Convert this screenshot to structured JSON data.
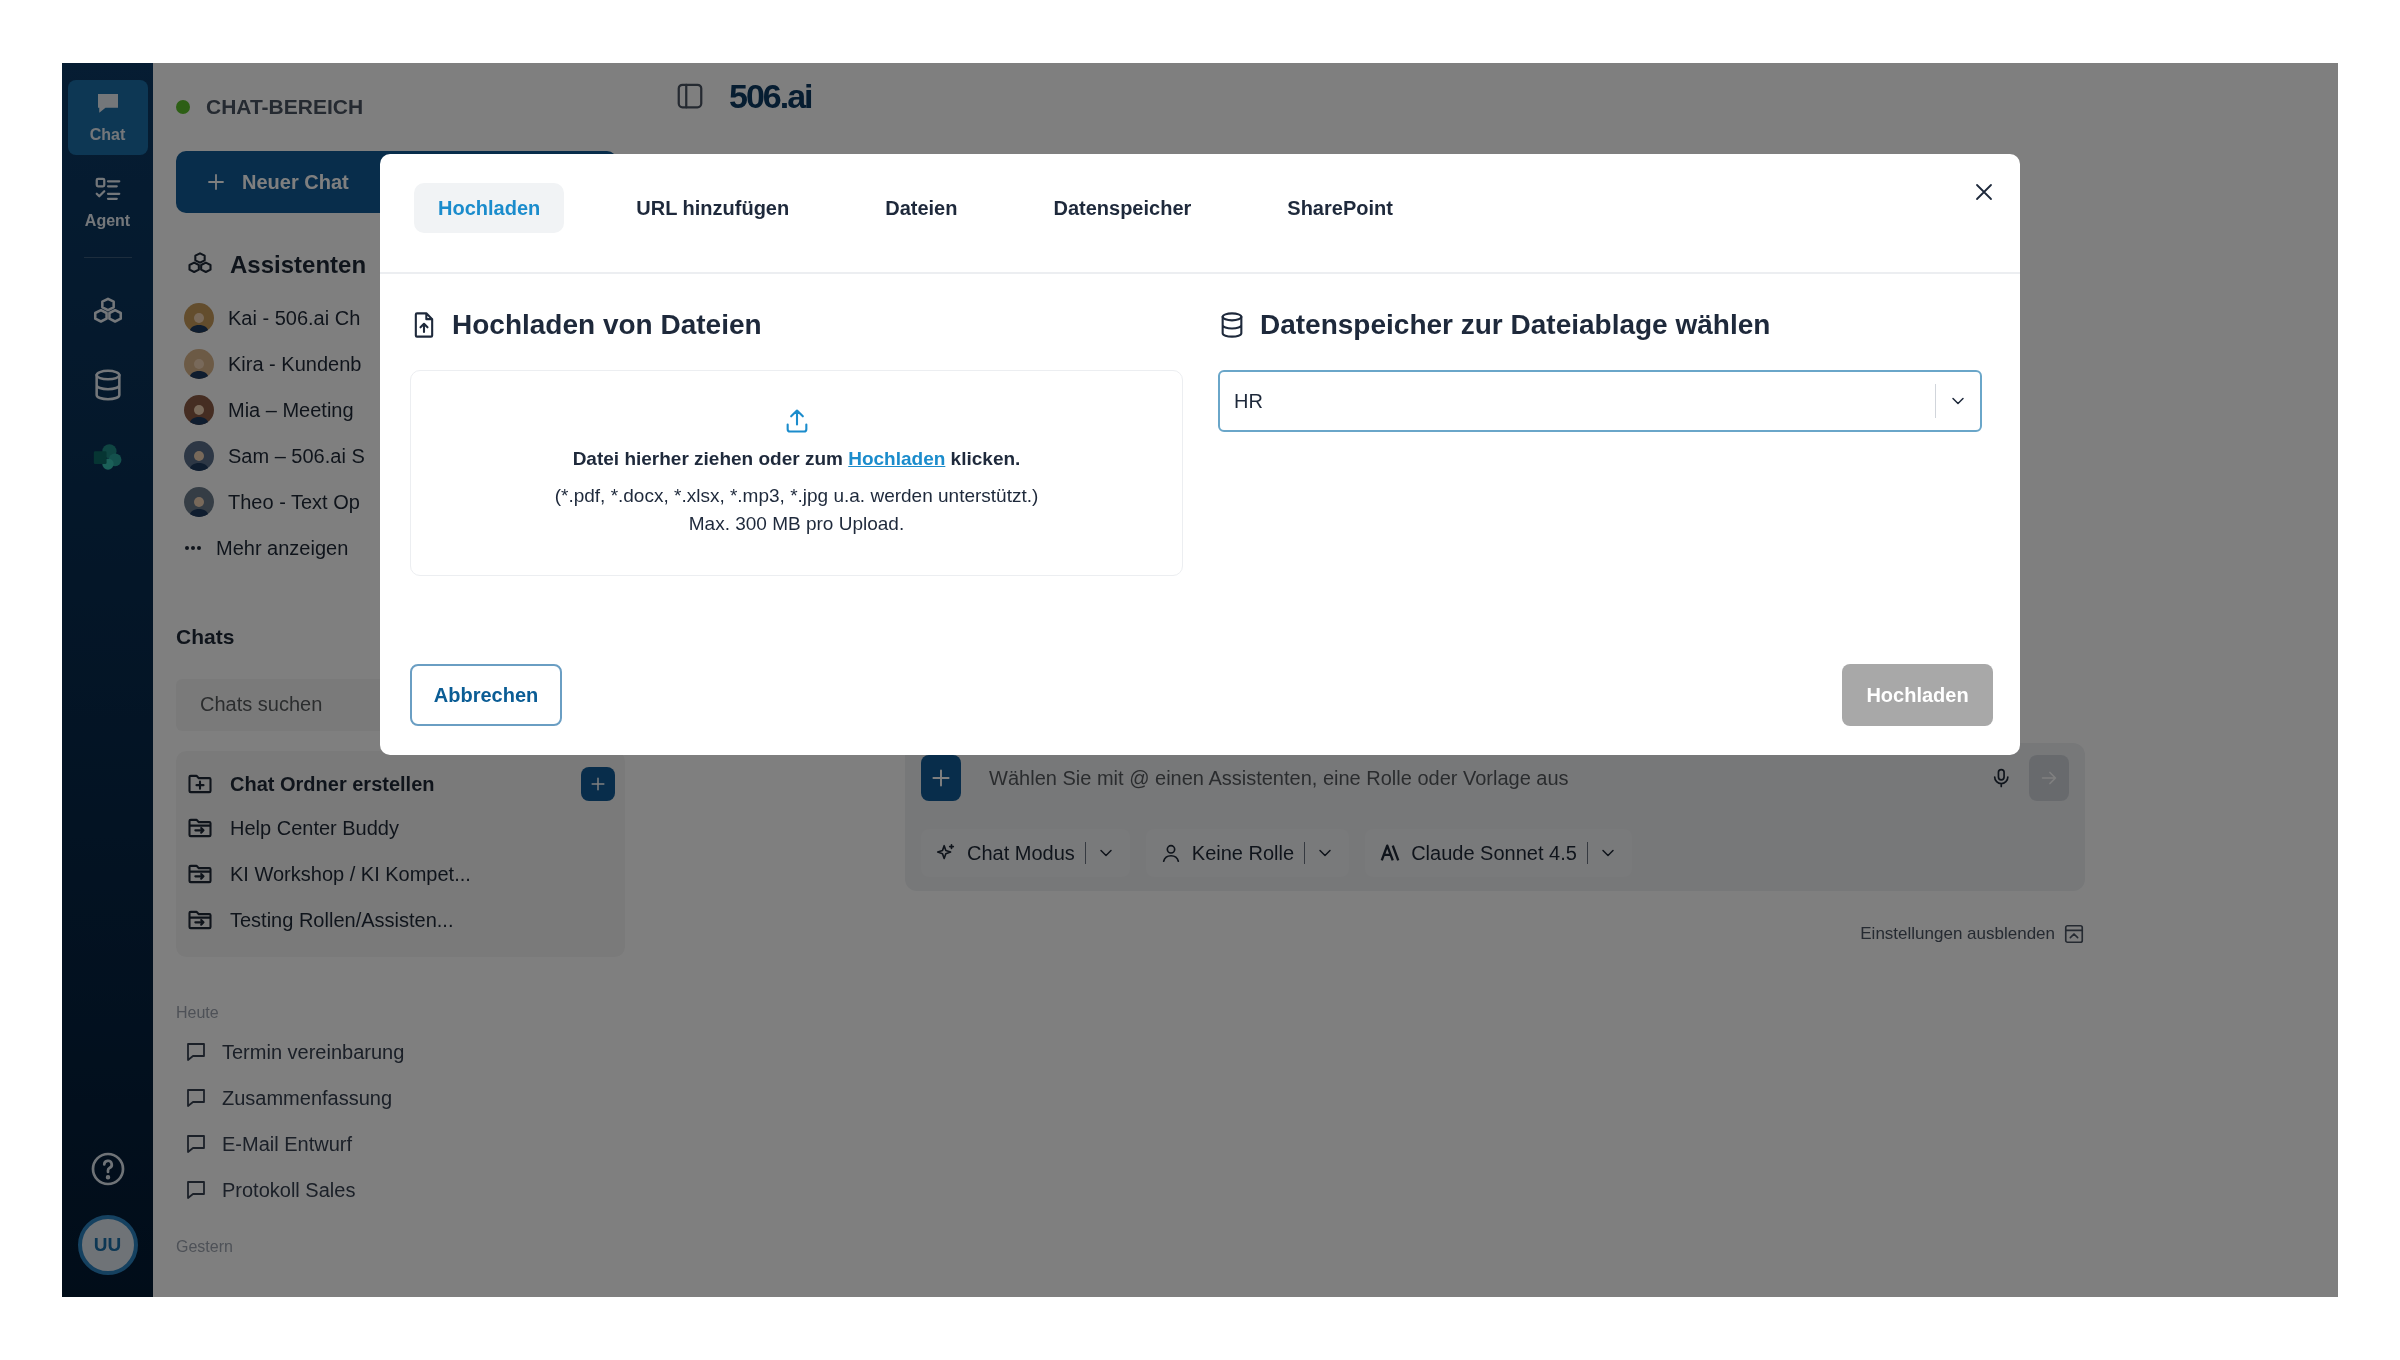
{
  "rail": {
    "items": [
      {
        "kind": "chat",
        "label": "Chat",
        "selected": true
      },
      {
        "kind": "agent",
        "label": "Agent",
        "selected": false
      },
      {
        "kind": "assistants",
        "selected": false
      },
      {
        "kind": "database",
        "selected": false
      },
      {
        "kind": "sharepoint",
        "selected": false
      }
    ],
    "avatar": "UU"
  },
  "sidebar": {
    "area_title": "CHAT-BEREICH",
    "new_chat": "Neuer Chat",
    "assistants_title": "Assistenten",
    "assistants": [
      {
        "name": "Kai - 506.ai Ch"
      },
      {
        "name": "Kira - Kundenb"
      },
      {
        "name": "Mia – Meeting"
      },
      {
        "name": "Sam – 506.ai S"
      },
      {
        "name": "Theo - Text Op"
      }
    ],
    "more": "Mehr anzeigen",
    "chats_title": "Chats",
    "search": {
      "placeholder": "Chats suchen"
    },
    "folder_create": "Chat Ordner erstellen",
    "folders": [
      {
        "name": "Help Center Buddy"
      },
      {
        "name": "KI Workshop / KI Kompet..."
      },
      {
        "name": "Testing Rollen/Assisten..."
      }
    ],
    "groups": [
      {
        "label": "Heute",
        "items": [
          {
            "title": "Termin vereinbarung"
          },
          {
            "title": "Zusammenfassung"
          },
          {
            "title": "E-Mail Entwurf"
          },
          {
            "title": "Protokoll Sales"
          }
        ]
      },
      {
        "label": "Gestern"
      }
    ]
  },
  "main": {
    "logo": "506.ai",
    "composer": {
      "placeholder": "Wählen Sie mit @ einen Assistenten, eine Rolle oder Vorlage aus",
      "send": {
        "disabled": true
      },
      "chips": [
        {
          "kind": "mode",
          "label": "Chat Modus"
        },
        {
          "kind": "role",
          "label": "Keine Rolle"
        },
        {
          "kind": "model",
          "label": "Claude Sonnet 4.5"
        }
      ]
    },
    "hide_settings": "Einstellungen ausblenden"
  },
  "modal": {
    "tabs": [
      {
        "label": "Hochladen",
        "selected": true
      },
      {
        "label": "URL hinzufügen",
        "selected": false
      },
      {
        "label": "Dateien",
        "selected": false
      },
      {
        "label": "Datenspeicher",
        "selected": false
      },
      {
        "label": "SharePoint",
        "selected": false
      }
    ],
    "upload": {
      "title": "Hochladen von Dateien",
      "prompt": [
        "Datei hierher ziehen oder zum",
        "Hochladen",
        "klicken."
      ],
      "formats": "(*.pdf, *.docx, *.xlsx, *.mp3, *.jpg u.a. werden unterstützt.)",
      "limit": "Max. 300 MB pro Upload."
    },
    "storage": {
      "title": "Datenspeicher zur Dateiablage wählen",
      "value": "HR"
    },
    "cancel": "Abbrechen",
    "submit": {
      "label": "Hochladen",
      "disabled": true
    }
  }
}
